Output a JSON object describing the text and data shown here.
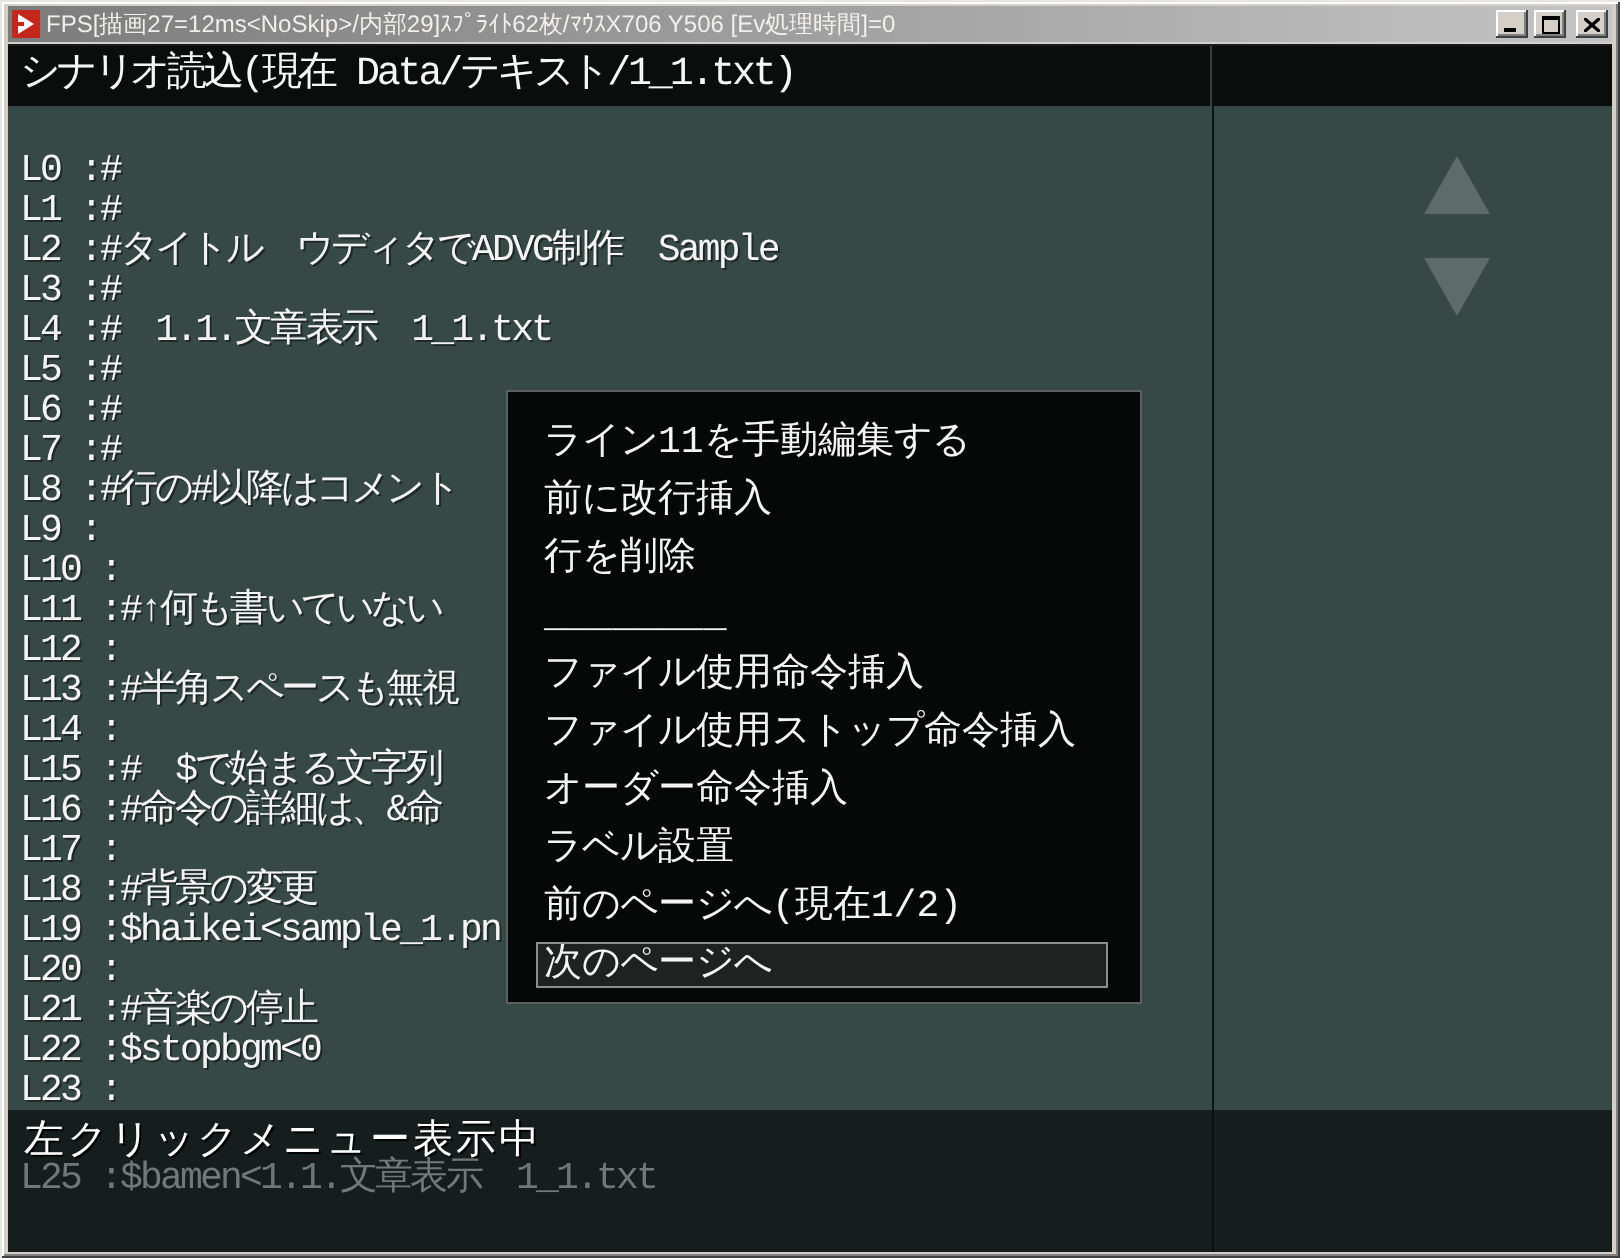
{
  "window": {
    "title": "FPS[描画27=12ms<NoSkip>/内部29]ｽﾌﾟﾗｲﾄ62枚/ﾏｳｽX706 Y506 [Ev処理時間]=0"
  },
  "header": {
    "title": "シナリオ読込(現在 Data/テキスト/1_1.txt)"
  },
  "script_lines": [
    "L0 :#",
    "L1 :#",
    "L2 :#タイトル　ウディタでADVG制作　Sample",
    "L3 :#",
    "L4 :#　1.1.文章表示　1_1.txt",
    "L5 :#",
    "L6 :#",
    "L7 :#",
    "L8 :#行の#以降はコメント",
    "L9 :",
    "L10 :",
    "L11 :#↑何も書いていない",
    "L12 :",
    "L13 :#半角スペースも無視",
    "L14 :",
    "L15 :#　$で始まる文字列",
    "L16 :#命令の詳細は、&命",
    "L17 :",
    "L18 :#背景の変更",
    "L19 :$haikei<sample_1.pn",
    "L20 :",
    "L21 :#音楽の停止",
    "L22 :$stopbgm<0",
    "L23 :"
  ],
  "context_menu": {
    "items": [
      {
        "label": "ライン11を手動編集する",
        "selected": false
      },
      {
        "label": "前に改行挿入",
        "selected": false
      },
      {
        "label": "行を削除",
        "selected": false
      },
      {
        "label": "________",
        "selected": false
      },
      {
        "label": "ファイル使用命令挿入",
        "selected": false
      },
      {
        "label": "ファイル使用ストップ命令挿入",
        "selected": false
      },
      {
        "label": "オーダー命令挿入",
        "selected": false
      },
      {
        "label": "ラベル設置",
        "selected": false
      },
      {
        "label": "前のページへ(現在1/2)",
        "selected": false
      },
      {
        "label": "次のページへ",
        "selected": true
      }
    ]
  },
  "status_bar": {
    "message": "左クリックメニュー表示中",
    "shaded_line": "L25 :$bamen<1.1.文章表示　1_1.txt"
  }
}
